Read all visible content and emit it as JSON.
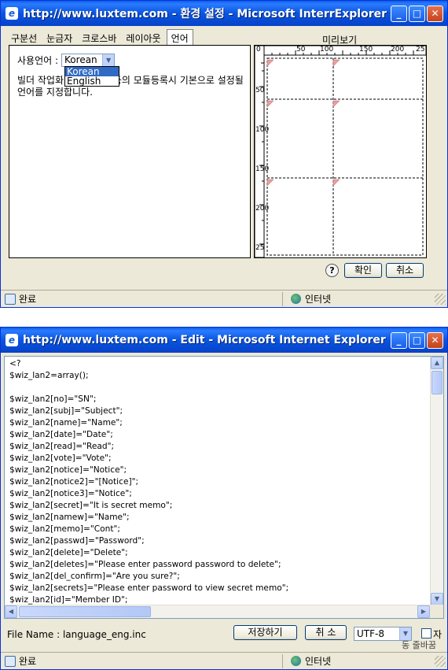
{
  "window1": {
    "title": "http://www.luxtem.com - 환경 설정 - Microsoft InterrExplorer",
    "tabs": [
      "구분선",
      "눈금자",
      "크로스바",
      "레이아웃",
      "언어"
    ],
    "active_tab": "언어",
    "language_label": "사용언어 :",
    "language_selected": "Korean",
    "language_options": [
      "Korean",
      "English"
    ],
    "description": "빌더 작업화면 및 게시판등의 모듈등록시 기본으로 설정될 언어를 지정합니다.",
    "preview_label": "미리보기",
    "ruler_top_labels": [
      "0",
      "50",
      "100",
      "150",
      "200",
      "25"
    ],
    "ruler_left_labels": [
      "0",
      "50",
      "100",
      "150",
      "200",
      "25"
    ],
    "help_label": "?",
    "ok_label": "확인",
    "cancel_label": "취소",
    "status_text": "완료",
    "zone_text": "인터넷"
  },
  "window2": {
    "title": "http://www.luxtem.com - Edit - Microsoft Internet Explorer",
    "code_lines": [
      "<?",
      "$wiz_lan2=array();",
      "",
      "$wiz_lan2[no]=\"SN\";",
      "$wiz_lan2[subj]=\"Subject\";",
      "$wiz_lan2[name]=\"Name\";",
      "$wiz_lan2[date]=\"Date\";",
      "$wiz_lan2[read]=\"Read\";",
      "$wiz_lan2[vote]=\"Vote\";",
      "$wiz_lan2[notice]=\"Notice\";",
      "$wiz_lan2[notice2]=\"[Notice]\";",
      "$wiz_lan2[notice3]=\"Notice\";",
      "$wiz_lan2[secret]=\"It is secret memo\";",
      "$wiz_lan2[namew]=\"Name\";",
      "$wiz_lan2[memo]=\"Cont\";",
      "$wiz_lan2[passwd]=\"Password\";",
      "$wiz_lan2[delete]=\"Delete\";",
      "$wiz_lan2[deletes]=\"Please enter password password to delete\";",
      "$wiz_lan2[del_confirm]=\"Are you sure?\";",
      "$wiz_lan2[secrets]=\"Please enter password to view secret memo\";",
      "$wiz_lan2[id]=\"Member ID\";"
    ],
    "file_label": "File Name : language_eng.inc",
    "save_label": "저장하기",
    "cancel_label": "취 소",
    "encoding": "UTF-8",
    "checkbox_label": "자",
    "checkbox_sublabel": "동 줄바꿈",
    "status_text": "완료",
    "zone_text": "인터넷"
  },
  "colors": {
    "titlebar": "#0a55df",
    "window_bg": "#ece9d8",
    "selection": "#316ac5",
    "preview_marker": "#e8a0a0"
  }
}
